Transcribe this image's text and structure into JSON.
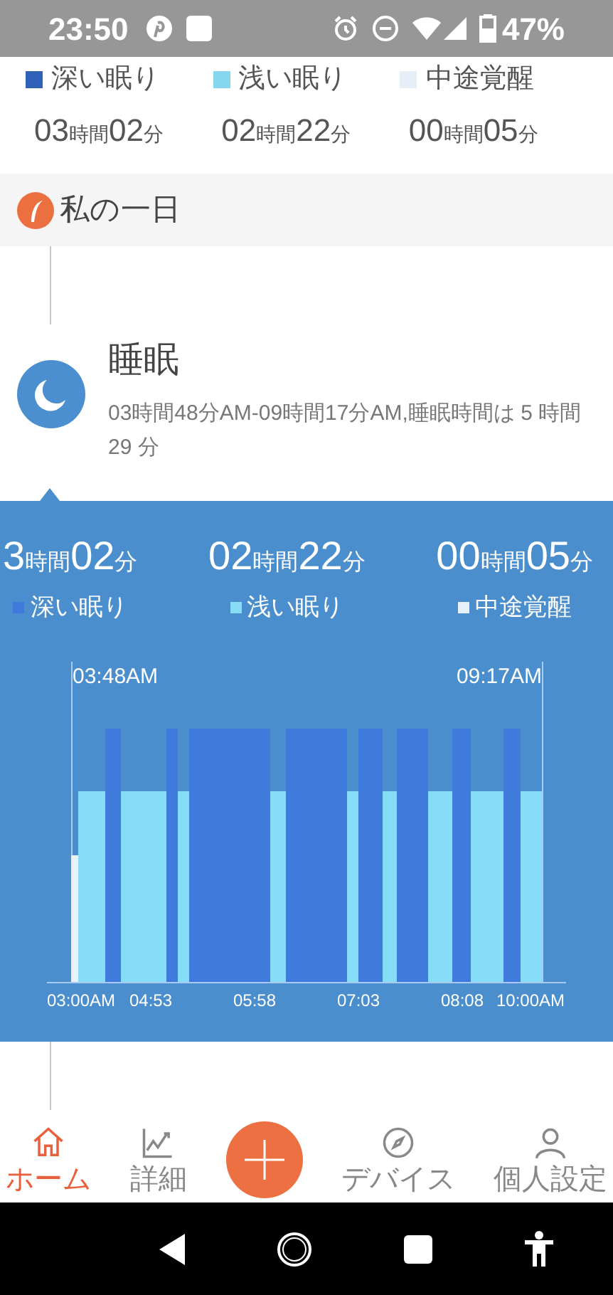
{
  "status_bar": {
    "time": "23:50",
    "battery": "47%"
  },
  "summary": [
    {
      "label": "深い眠り",
      "hours": "03",
      "hours_unit": "時間",
      "minutes": "02",
      "minutes_unit": "分",
      "color": "#2f62b8"
    },
    {
      "label": "浅い眠り",
      "hours": "02",
      "hours_unit": "時間",
      "minutes": "22",
      "minutes_unit": "分",
      "color": "#84d6ef"
    },
    {
      "label": "中途覚醒",
      "hours": "00",
      "hours_unit": "時間",
      "minutes": "05",
      "minutes_unit": "分",
      "color": "#e6eef8"
    }
  ],
  "section": {
    "title": "私の一日"
  },
  "event": {
    "title": "睡眠",
    "description": "03時間48分AM-09時間17分AM,睡眠時間は 5 時間 29 分"
  },
  "chart_panel": {
    "stats": [
      {
        "label": "深い眠り",
        "hours": "3",
        "hours_unit": "時間",
        "minutes": "02",
        "minutes_unit": "分",
        "color": "#3f7bdc"
      },
      {
        "label": "浅い眠り",
        "hours": "02",
        "hours_unit": "時間",
        "minutes": "22",
        "minutes_unit": "分",
        "color": "#87dcf7"
      },
      {
        "label": "中途覚醒",
        "hours": "00",
        "hours_unit": "時間",
        "minutes": "05",
        "minutes_unit": "分",
        "color": "#e8f0fa"
      }
    ],
    "start_time": "03:48AM",
    "end_time": "09:17AM",
    "axis_labels": [
      "03:00AM",
      "04:53",
      "05:58",
      "07:03",
      "08:08",
      "10:00AM"
    ]
  },
  "nav": [
    {
      "label": "ホーム",
      "kind": "home",
      "selected": true
    },
    {
      "label": "詳細",
      "kind": "chart",
      "selected": false
    },
    {
      "label": "デバイス",
      "kind": "compass",
      "selected": false
    },
    {
      "label": "個人設定",
      "kind": "person",
      "selected": false
    }
  ]
}
